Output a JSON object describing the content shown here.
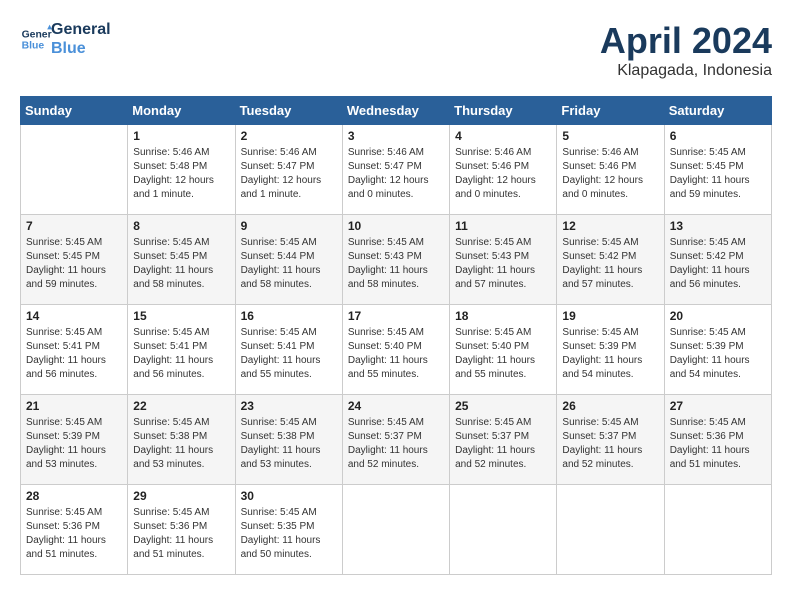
{
  "header": {
    "logo_line1": "General",
    "logo_line2": "Blue",
    "month_title": "April 2024",
    "location": "Klapagada, Indonesia"
  },
  "weekdays": [
    "Sunday",
    "Monday",
    "Tuesday",
    "Wednesday",
    "Thursday",
    "Friday",
    "Saturday"
  ],
  "weeks": [
    [
      {
        "day": "",
        "sunrise": "",
        "sunset": "",
        "daylight": ""
      },
      {
        "day": "1",
        "sunrise": "Sunrise: 5:46 AM",
        "sunset": "Sunset: 5:48 PM",
        "daylight": "Daylight: 12 hours and 1 minute."
      },
      {
        "day": "2",
        "sunrise": "Sunrise: 5:46 AM",
        "sunset": "Sunset: 5:47 PM",
        "daylight": "Daylight: 12 hours and 1 minute."
      },
      {
        "day": "3",
        "sunrise": "Sunrise: 5:46 AM",
        "sunset": "Sunset: 5:47 PM",
        "daylight": "Daylight: 12 hours and 0 minutes."
      },
      {
        "day": "4",
        "sunrise": "Sunrise: 5:46 AM",
        "sunset": "Sunset: 5:46 PM",
        "daylight": "Daylight: 12 hours and 0 minutes."
      },
      {
        "day": "5",
        "sunrise": "Sunrise: 5:46 AM",
        "sunset": "Sunset: 5:46 PM",
        "daylight": "Daylight: 12 hours and 0 minutes."
      },
      {
        "day": "6",
        "sunrise": "Sunrise: 5:45 AM",
        "sunset": "Sunset: 5:45 PM",
        "daylight": "Daylight: 11 hours and 59 minutes."
      }
    ],
    [
      {
        "day": "7",
        "sunrise": "Sunrise: 5:45 AM",
        "sunset": "Sunset: 5:45 PM",
        "daylight": "Daylight: 11 hours and 59 minutes."
      },
      {
        "day": "8",
        "sunrise": "Sunrise: 5:45 AM",
        "sunset": "Sunset: 5:45 PM",
        "daylight": "Daylight: 11 hours and 58 minutes."
      },
      {
        "day": "9",
        "sunrise": "Sunrise: 5:45 AM",
        "sunset": "Sunset: 5:44 PM",
        "daylight": "Daylight: 11 hours and 58 minutes."
      },
      {
        "day": "10",
        "sunrise": "Sunrise: 5:45 AM",
        "sunset": "Sunset: 5:43 PM",
        "daylight": "Daylight: 11 hours and 58 minutes."
      },
      {
        "day": "11",
        "sunrise": "Sunrise: 5:45 AM",
        "sunset": "Sunset: 5:43 PM",
        "daylight": "Daylight: 11 hours and 57 minutes."
      },
      {
        "day": "12",
        "sunrise": "Sunrise: 5:45 AM",
        "sunset": "Sunset: 5:42 PM",
        "daylight": "Daylight: 11 hours and 57 minutes."
      },
      {
        "day": "13",
        "sunrise": "Sunrise: 5:45 AM",
        "sunset": "Sunset: 5:42 PM",
        "daylight": "Daylight: 11 hours and 56 minutes."
      }
    ],
    [
      {
        "day": "14",
        "sunrise": "Sunrise: 5:45 AM",
        "sunset": "Sunset: 5:41 PM",
        "daylight": "Daylight: 11 hours and 56 minutes."
      },
      {
        "day": "15",
        "sunrise": "Sunrise: 5:45 AM",
        "sunset": "Sunset: 5:41 PM",
        "daylight": "Daylight: 11 hours and 56 minutes."
      },
      {
        "day": "16",
        "sunrise": "Sunrise: 5:45 AM",
        "sunset": "Sunset: 5:41 PM",
        "daylight": "Daylight: 11 hours and 55 minutes."
      },
      {
        "day": "17",
        "sunrise": "Sunrise: 5:45 AM",
        "sunset": "Sunset: 5:40 PM",
        "daylight": "Daylight: 11 hours and 55 minutes."
      },
      {
        "day": "18",
        "sunrise": "Sunrise: 5:45 AM",
        "sunset": "Sunset: 5:40 PM",
        "daylight": "Daylight: 11 hours and 55 minutes."
      },
      {
        "day": "19",
        "sunrise": "Sunrise: 5:45 AM",
        "sunset": "Sunset: 5:39 PM",
        "daylight": "Daylight: 11 hours and 54 minutes."
      },
      {
        "day": "20",
        "sunrise": "Sunrise: 5:45 AM",
        "sunset": "Sunset: 5:39 PM",
        "daylight": "Daylight: 11 hours and 54 minutes."
      }
    ],
    [
      {
        "day": "21",
        "sunrise": "Sunrise: 5:45 AM",
        "sunset": "Sunset: 5:39 PM",
        "daylight": "Daylight: 11 hours and 53 minutes."
      },
      {
        "day": "22",
        "sunrise": "Sunrise: 5:45 AM",
        "sunset": "Sunset: 5:38 PM",
        "daylight": "Daylight: 11 hours and 53 minutes."
      },
      {
        "day": "23",
        "sunrise": "Sunrise: 5:45 AM",
        "sunset": "Sunset: 5:38 PM",
        "daylight": "Daylight: 11 hours and 53 minutes."
      },
      {
        "day": "24",
        "sunrise": "Sunrise: 5:45 AM",
        "sunset": "Sunset: 5:37 PM",
        "daylight": "Daylight: 11 hours and 52 minutes."
      },
      {
        "day": "25",
        "sunrise": "Sunrise: 5:45 AM",
        "sunset": "Sunset: 5:37 PM",
        "daylight": "Daylight: 11 hours and 52 minutes."
      },
      {
        "day": "26",
        "sunrise": "Sunrise: 5:45 AM",
        "sunset": "Sunset: 5:37 PM",
        "daylight": "Daylight: 11 hours and 52 minutes."
      },
      {
        "day": "27",
        "sunrise": "Sunrise: 5:45 AM",
        "sunset": "Sunset: 5:36 PM",
        "daylight": "Daylight: 11 hours and 51 minutes."
      }
    ],
    [
      {
        "day": "28",
        "sunrise": "Sunrise: 5:45 AM",
        "sunset": "Sunset: 5:36 PM",
        "daylight": "Daylight: 11 hours and 51 minutes."
      },
      {
        "day": "29",
        "sunrise": "Sunrise: 5:45 AM",
        "sunset": "Sunset: 5:36 PM",
        "daylight": "Daylight: 11 hours and 51 minutes."
      },
      {
        "day": "30",
        "sunrise": "Sunrise: 5:45 AM",
        "sunset": "Sunset: 5:35 PM",
        "daylight": "Daylight: 11 hours and 50 minutes."
      },
      {
        "day": "",
        "sunrise": "",
        "sunset": "",
        "daylight": ""
      },
      {
        "day": "",
        "sunrise": "",
        "sunset": "",
        "daylight": ""
      },
      {
        "day": "",
        "sunrise": "",
        "sunset": "",
        "daylight": ""
      },
      {
        "day": "",
        "sunrise": "",
        "sunset": "",
        "daylight": ""
      }
    ]
  ]
}
